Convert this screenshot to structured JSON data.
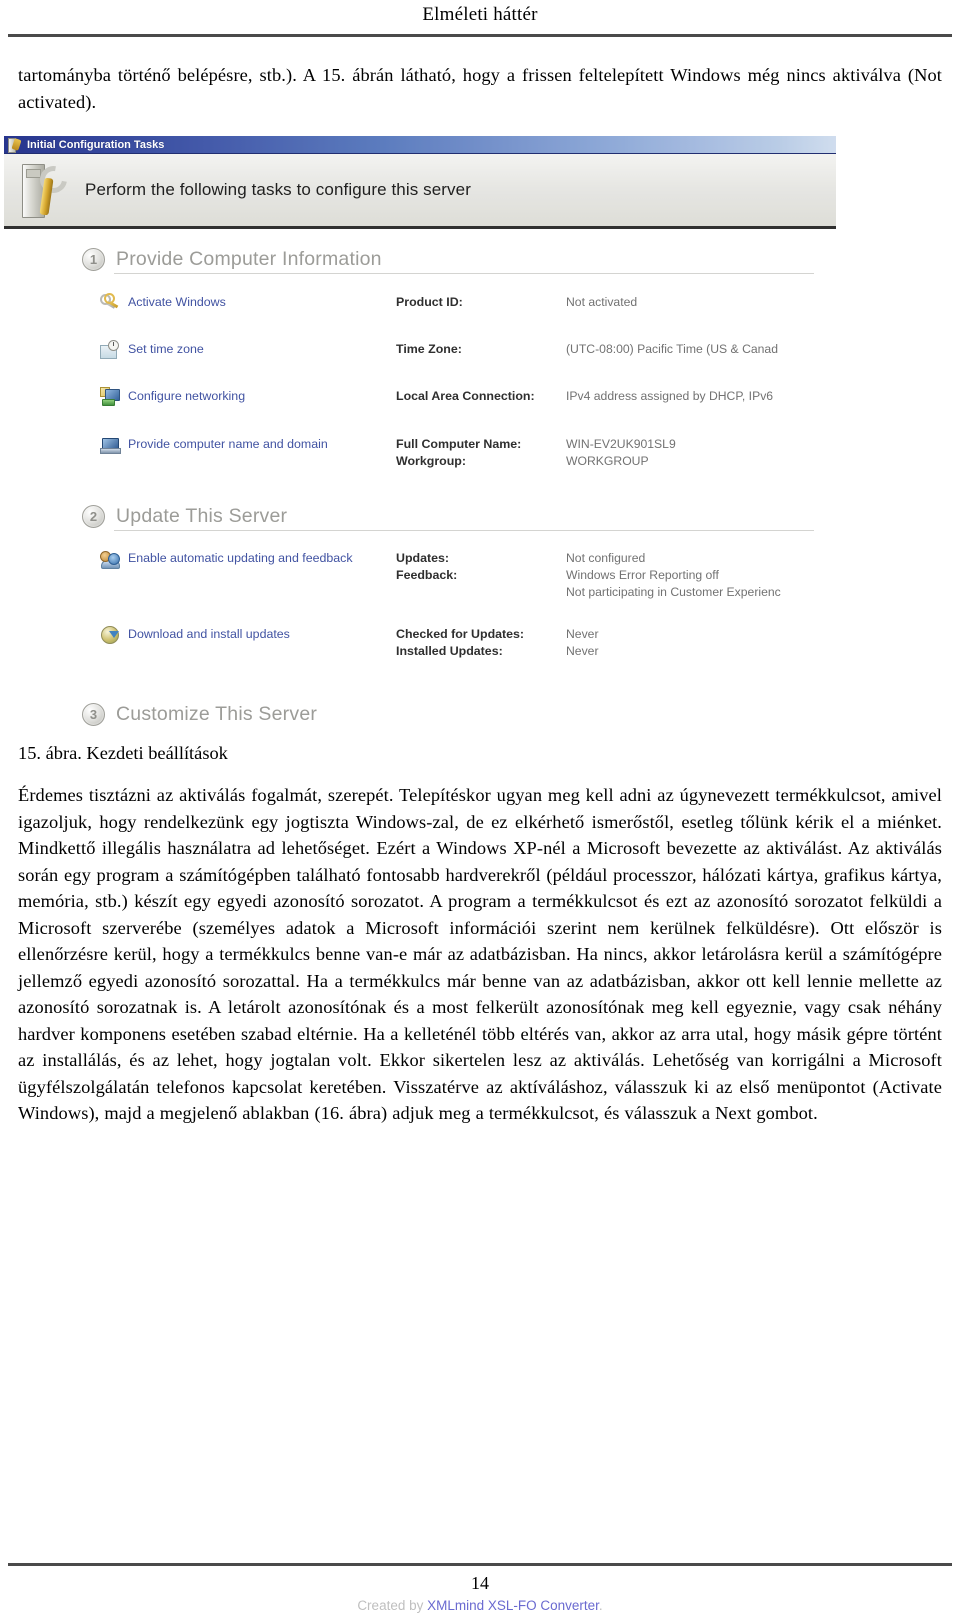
{
  "header": {
    "running_title": "Elméleti háttér"
  },
  "intro_paragraph": "tartományba történő belépésre, stb.). A 15. ábrán látható, hogy a frissen feltelepített Windows még nincs aktiválva (Not activated).",
  "figure": {
    "caption": "15. ábra. Kezdeti beállítások",
    "window": {
      "title": "Initial Configuration Tasks",
      "banner_text": "Perform the following tasks to configure this server",
      "title_icon": "server-wrench-icon",
      "banner_icon": "server-wrench-large-icon"
    },
    "sections": [
      {
        "number": "1",
        "title": "Provide Computer Information",
        "tasks": [
          {
            "icon": "keys-icon",
            "link": "Activate Windows",
            "labels": [
              "Product ID:"
            ],
            "values": [
              "Not activated"
            ]
          },
          {
            "icon": "clock-icon",
            "link": "Set time zone",
            "labels": [
              "Time Zone:"
            ],
            "values": [
              "(UTC-08:00) Pacific Time (US & Canad"
            ]
          },
          {
            "icon": "network-icon",
            "link": "Configure networking",
            "labels": [
              "Local Area Connection:"
            ],
            "values": [
              "IPv4 address assigned by DHCP, IPv6"
            ]
          },
          {
            "icon": "computer-icon",
            "link": "Provide computer name and domain",
            "labels": [
              "Full Computer Name:",
              "Workgroup:"
            ],
            "values": [
              "WIN-EV2UK901SL9",
              "WORKGROUP"
            ]
          }
        ]
      },
      {
        "number": "2",
        "title": "Update This Server",
        "tasks": [
          {
            "icon": "users-feedback-icon",
            "link": "Enable automatic updating and feedback",
            "labels": [
              "Updates:",
              "Feedback:"
            ],
            "values": [
              "Not configured",
              "Windows Error Reporting off",
              "Not participating in Customer Experienc"
            ]
          },
          {
            "icon": "download-updates-icon",
            "link": "Download and install updates",
            "labels": [
              "Checked for Updates:",
              "Installed Updates:"
            ],
            "values": [
              "Never",
              "Never"
            ]
          }
        ]
      },
      {
        "number": "3",
        "title": "Customize This Server",
        "tasks": []
      }
    ]
  },
  "main_paragraph": "Érdemes tisztázni az aktiválás fogalmát, szerepét. Telepítéskor ugyan meg kell adni az úgynevezett termékkulcsot, amivel igazoljuk, hogy rendelkezünk egy jogtiszta Windows-zal, de ez elkérhető ismerőstől, esetleg tőlünk kérik el a miénket. Mindkettő illegális használatra ad lehetőséget. Ezért a Windows XP-nél a Microsoft bevezette az aktiválást. Az aktiválás során egy program a számítógépben található fontosabb hardverekről (például processzor, hálózati kártya, grafikus kártya, memória, stb.) készít egy egyedi azonosító sorozatot. A program a termékkulcsot és ezt az azonosító sorozatot felküldi a Microsoft szerverébe (személyes adatok a Microsoft információi szerint nem kerülnek felküldésre). Ott először is ellenőrzésre kerül, hogy a termékkulcs benne van-e már az adatbázisban. Ha nincs, akkor letárolásra kerül a számítógépre jellemző egyedi azonosító sorozattal. Ha a termékkulcs már benne van az adatbázisban, akkor ott kell lennie mellette az azonosító sorozatnak is. A letárolt azonosítónak és a most felkerült azonosítónak meg kell egyeznie, vagy csak néhány hardver komponens esetében szabad eltérnie. Ha a kelleténél több eltérés van, akkor az arra utal, hogy másik gépre történt az installálás, és az lehet, hogy jogtalan volt. Ekkor sikertelen lesz az aktiválás. Lehetőség van korrigálni a Microsoft ügyfélszolgálatán telefonos kapcsolat keretében. Visszatérve az aktíváláshoz, válasszuk ki az első menüpontot (Activate Windows), majd a megjelenő ablakban (16. ábra) adjuk meg a termékkulcsot, és válasszuk a Next gombot.",
  "footer": {
    "page_number": "14",
    "created_by_prefix": "Created by ",
    "created_by_link": "XMLmind XSL-FO Converter",
    "created_by_suffix": "."
  }
}
